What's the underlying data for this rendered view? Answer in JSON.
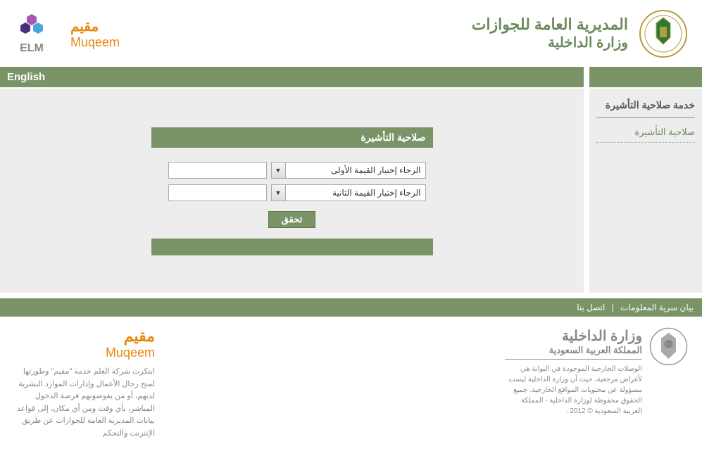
{
  "header": {
    "elm_label": "ELM",
    "muqeem_ar": "مقيم",
    "muqeem_en": "Muqeem",
    "jawazat_line1": "المديرية العامة للجوازات",
    "jawazat_line2": "وزارة الداخلية"
  },
  "nav": {
    "language": "English"
  },
  "sidebar": {
    "title": "خدمة صلاحية التأشيرة",
    "link": "صلاحية التأشيرة"
  },
  "form": {
    "title": "صلاحية التأشيرة",
    "select1": "الرجاء إختيار القيمة الأولى",
    "select2": "الرجاء إختيار القيمة الثانية",
    "verify": "تحقق"
  },
  "footer_bar": {
    "privacy": "بيان سرية المعلومات",
    "contact": "اتصل بنا"
  },
  "footer": {
    "muqeem_ar": "مقيم",
    "muqeem_en": "Muqeem",
    "description": "ابتكرت شركة العلم خدمة \"مقيم\" وطورتها لمنح رجال الأعمال وإدارات الموارد البشرية لديهم، أو من يفوضونهم فرصة الدخول المباشر، بأي وقت ومن أي مكان، إلى قواعد بيانات المديرية العامة للجوازات عن طريق الإنترنت والتحكم",
    "moi_line1": "وزارة الداخلية",
    "moi_line2": "المملكة العربية السعودية",
    "moi_disclaimer": "الوصلات الخارجية الموجودة في البوابة هي لأغراض مرجعية، حيث أن وزارة الداخلية ليست مسؤولة عن محتويات المواقع الخارجية. جميع الحقوق محفوظة لوزارة الداخلية - المملكة العربية السعودية © 2012 ."
  }
}
